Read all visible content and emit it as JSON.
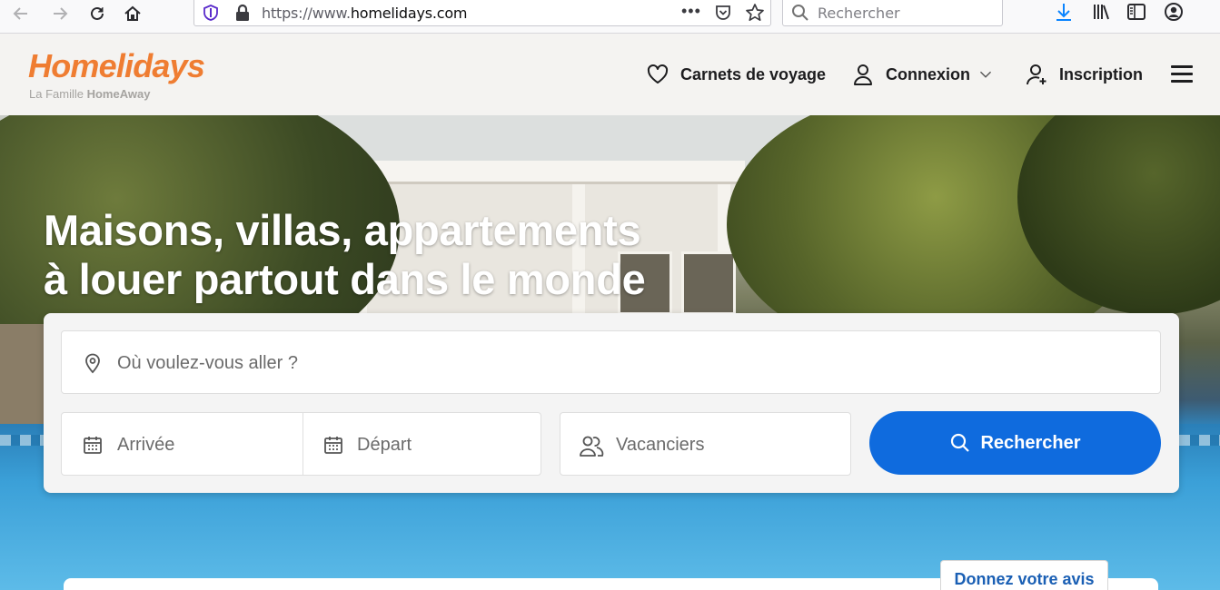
{
  "browser": {
    "url_scheme": "https://www.",
    "url_host": "homelidays.com",
    "search_placeholder": "Rechercher",
    "menu_dots": "•••"
  },
  "header": {
    "logo": "Homelidays",
    "tagline_prefix": "La Famille",
    "tagline_brand": "HomeAway",
    "nav": {
      "wishlist": "Carnets de voyage",
      "login": "Connexion",
      "signup": "Inscription"
    }
  },
  "hero": {
    "title_line1": "Maisons, villas, appartements",
    "title_line2": "à louer partout dans le monde"
  },
  "search": {
    "destination_placeholder": "Où voulez-vous aller ?",
    "checkin_placeholder": "Arrivée",
    "checkout_placeholder": "Départ",
    "guests_placeholder": "Vacanciers",
    "submit_label": "Rechercher"
  },
  "feedback": {
    "label": "Donnez votre avis"
  },
  "colors": {
    "brand_orange": "#ef7d32",
    "button_blue": "#0f6bde",
    "header_bg": "#f4f3f1"
  },
  "icons": [
    "back-arrow-icon",
    "forward-arrow-icon",
    "reload-icon",
    "home-icon",
    "shield-icon",
    "lock-icon",
    "pocket-icon",
    "star-icon",
    "search-icon",
    "download-icon",
    "library-icon",
    "sidebar-icon",
    "account-icon",
    "heart-icon",
    "user-icon",
    "chevron-down-icon",
    "add-user-icon",
    "menu-icon",
    "location-pin-icon",
    "calendar-icon",
    "people-icon"
  ]
}
